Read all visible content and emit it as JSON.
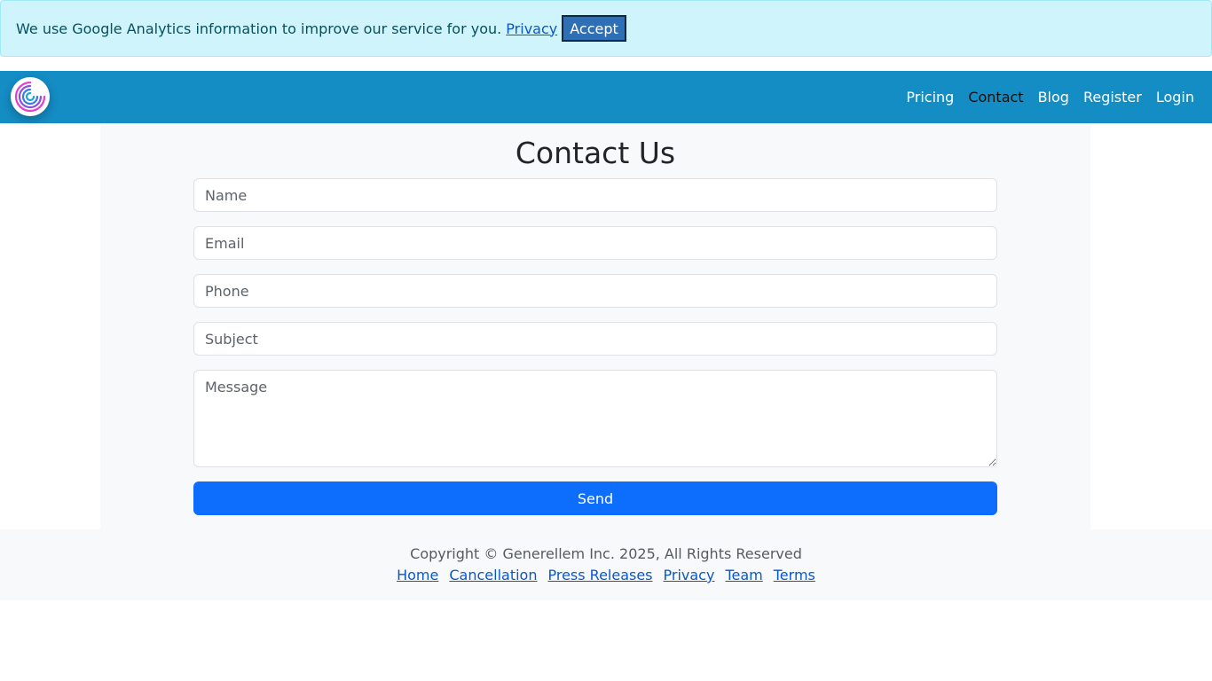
{
  "cookie_banner": {
    "message": "We use Google Analytics information to improve our service for you. ",
    "privacy_link": "Privacy",
    "accept_label": "Accept"
  },
  "navbar": {
    "logo_icon": "spiral-logo-icon",
    "links": [
      {
        "label": "Pricing",
        "active": false
      },
      {
        "label": "Contact",
        "active": true
      },
      {
        "label": "Blog",
        "active": false
      },
      {
        "label": "Register",
        "active": false
      },
      {
        "label": "Login",
        "active": false
      }
    ]
  },
  "main": {
    "title": "Contact Us",
    "form": {
      "name_placeholder": "Name",
      "email_placeholder": "Email",
      "phone_placeholder": "Phone",
      "subject_placeholder": "Subject",
      "message_placeholder": "Message",
      "send_label": "Send"
    }
  },
  "footer": {
    "copyright": "Copyright © Generellem Inc. 2025, All Rights Reserved",
    "links": [
      "Home",
      "Cancellation",
      "Press Releases",
      "Privacy",
      "Team",
      "Terms"
    ]
  },
  "colors": {
    "banner_bg": "#cff4fc",
    "navbar_bg": "#148cc4",
    "primary_button": "#0d6efd",
    "link": "#0a58ca"
  }
}
